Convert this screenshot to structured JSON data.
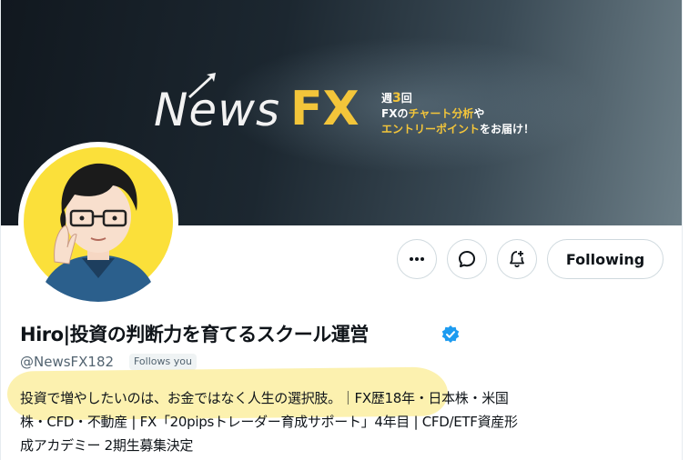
{
  "banner": {
    "logo_news": "News",
    "logo_fx": "FX",
    "tagline_week": "週",
    "tagline_count": "3",
    "tagline_times": "回",
    "tagline_line2_a": "FXの",
    "tagline_line2_b": "チャート分析",
    "tagline_line2_c": "や",
    "tagline_line3_a": "エントリーポイント",
    "tagline_line3_b": "をお届け！"
  },
  "actions": {
    "more_icon": "more-icon",
    "message_icon": "message-icon",
    "notify_icon": "bell-plus-icon",
    "follow_label": "Following"
  },
  "profile": {
    "display_name": "Hiro|投資の判断力を育てるスクール運営",
    "handle": "@NewsFX182",
    "follows_you": "Follows you",
    "bio_line1": "投資で増やしたいのは、お金ではなく人生の選択肢。｜FX歴18年・日本株・米国",
    "bio_line2": "株・CFD・不動産 | FX「20pipsトレーダー育成サポート」4年目 | CFD/ETF資産形",
    "bio_line3": "成アカデミー 2期生募集決定"
  },
  "colors": {
    "text": "#0f1419",
    "muted": "#536471",
    "verified": "#1d9bf0",
    "accent_yellow": "#f3c53a",
    "avatar_bg": "#fbe03a",
    "highlight": "#fae66e"
  }
}
